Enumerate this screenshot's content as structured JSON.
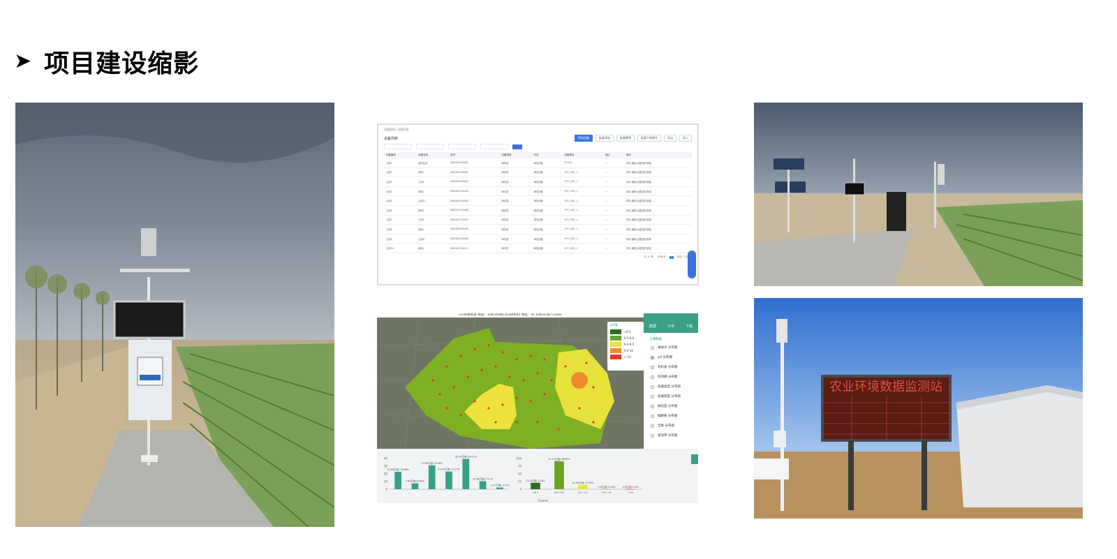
{
  "page": {
    "title": "项目建设缩影",
    "bullet_icon": "arrowhead-bullet"
  },
  "photos": [
    {
      "name": "weather-station-field-photo"
    },
    {
      "name": "sensor-array-field-photo"
    },
    {
      "name": "led-display-board-photo"
    }
  ],
  "device_table": {
    "breadcrumb": "设备管理 / 设备列表",
    "title": "设备列表",
    "buttons": [
      "添加设备",
      "批量添加",
      "批量删除",
      "批量下发指令",
      "导出",
      "导入"
    ],
    "search_button": "查询",
    "columns": [
      "设备编号",
      "设备名称",
      "型号",
      "设备类型",
      "状态",
      "设备属性",
      "地区",
      "操作"
    ],
    "rows": [
      [
        "土壤1",
        "墒情监测",
        "DB0162520001",
        "墒情类",
        "墒情设备",
        "STG01",
        "—",
        "详情 编辑 远程控制 删除"
      ],
      [
        "土壤2",
        "墒情1",
        "DB0162520002",
        "墒情类",
        "墒情设备",
        "OFF_SOIL_1",
        "—",
        "详情 编辑 远程控制 删除"
      ],
      [
        "土壤3",
        "土壤4",
        "DB0162520003",
        "墒情类",
        "墒情设备",
        "OFF_SOIL_1",
        "—",
        "详情 编辑 远程控制 删除"
      ],
      [
        "土壤4",
        "墒情1",
        "DB0162520004",
        "墒情类",
        "墒情设备",
        "OFF_SOIL_1",
        "—",
        "详情 编辑 远程控制 删除"
      ],
      [
        "土壤5",
        "土壤12",
        "DB0162520005",
        "墒情类",
        "墒情设备",
        "OFF_SOIL_1",
        "—",
        "详情 编辑 远程控制 删除"
      ],
      [
        "土壤6",
        "墒情1",
        "DB0162520006",
        "墒情类",
        "墒情设备",
        "OFF_SOIL_1",
        "—",
        "详情 编辑 远程控制 删除"
      ],
      [
        "土壤7",
        "土壤5",
        "DB0162520007",
        "墒情类",
        "墒情设备",
        "OFF_SOIL_1",
        "—",
        "详情 编辑 远程控制 删除"
      ],
      [
        "土壤8",
        "墒情4",
        "DB0162520008",
        "墒情类",
        "墒情设备",
        "OFF_SOIL_1",
        "—",
        "详情 编辑 远程控制 删除"
      ],
      [
        "土壤9",
        "土壤8",
        "DB0162520009",
        "墒情类",
        "墒情设备",
        "OFF_SOIL_1",
        "—",
        "详情 编辑 远程控制 删除"
      ],
      [
        "土壤10",
        "墒情4",
        "DB0162520010",
        "墒情类",
        "墒情设备",
        "OFF_SOIL_1",
        "—",
        "详情 编辑 远程控制 删除"
      ]
    ],
    "pager": {
      "total": "共 10 条",
      "page_size": "10条/页",
      "current": "1",
      "goto": "前往 1 页"
    }
  },
  "soil_map": {
    "header": "GC80坐标系     经度：108.0598135380643     纬度：41.0362238772583",
    "legend_title": "pH值",
    "legend": [
      {
        "label": "<6.5",
        "color": "#2d6e1e"
      },
      {
        "label": "6.5-9.0",
        "color": "#6aa31f"
      },
      {
        "label": "9.0-9.5",
        "color": "#ece23a"
      },
      {
        "label": "9.5-10",
        "color": "#ef8a30"
      },
      {
        "label": "> 10",
        "color": "#e03a2f"
      }
    ],
    "tabs": [
      "数据",
      "分布",
      "下载"
    ],
    "section_title": "土壤数据",
    "layers": [
      "采样点 分布图",
      "pH 分布图",
      "有机质 分布图",
      "有效磷 分布图",
      "盐碱类型 分布图",
      "盐碱程度 分布图",
      "碱化度 分布图",
      "碱解氮 分布图",
      "全氮 分布图",
      "速效钾 分布图"
    ],
    "selected_layer": "pH 分布图",
    "footer_label": "Charts"
  },
  "chart_data": [
    {
      "type": "bar",
      "categories": [
        "a",
        "b",
        "c",
        "d",
        "e",
        "f",
        "g"
      ],
      "values": [
        22.68,
        7.64,
        31.09,
        23.03,
        39.54,
        10.56,
        2.27
      ],
      "labels": [
        "22.68(万亩) 16.68%",
        "7.64(万亩) 5.62%",
        "31.09(万亩) 22.66%",
        "23.03(万亩) 17.15%",
        "39.54(万亩) 29.12%",
        "10.56(万亩) 7.41%",
        "2.27(万亩) 1.37%"
      ],
      "yticks": [
        "0",
        "10",
        "20",
        "30",
        "40"
      ],
      "ylim": [
        0,
        40
      ]
    },
    {
      "type": "bar",
      "categories": [
        "<6.5",
        "6.5~9.0",
        "9.0~9.5",
        "9.5~10",
        ">10"
      ],
      "values": [
        21.0,
        91.17,
        14.16,
        0.5,
        0.3
      ],
      "labels": [
        "21.0(万亩) 22.6%",
        "91.17(万亩) 66.87%",
        "14.16(万亩) 10.34%",
        "0.5(万亩) 0.44%",
        "0.3(万亩) 0.0%"
      ],
      "colors": [
        "#2d6e1e",
        "#6aa31f",
        "#ece23a",
        "#ef8a30",
        "#e03a2f"
      ],
      "yticks": [
        "0",
        "25",
        "50",
        "75",
        "100"
      ],
      "ylim": [
        0,
        100
      ]
    }
  ],
  "led_board": {
    "title": "农业环境数据监测站"
  }
}
